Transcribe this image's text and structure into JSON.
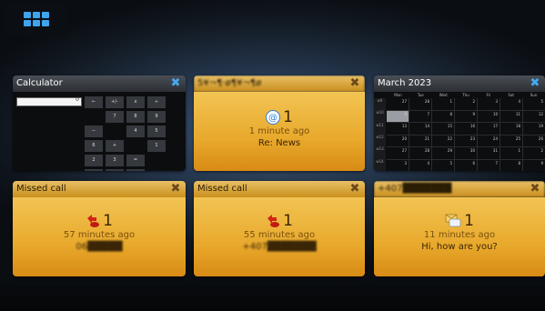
{
  "launcher": {
    "icon": "app-grid-icon"
  },
  "calculator": {
    "title": "Calculator",
    "display": "0",
    "keys": [
      "←",
      "+/-",
      "x",
      "÷",
      "",
      "7",
      "8",
      "9",
      "−",
      "",
      "4",
      "5",
      "6",
      "+",
      "",
      "1",
      "2",
      "3",
      "=",
      "",
      "0",
      ".",
      ""
    ]
  },
  "email": {
    "title": "5¥¬¶·ø¶¥¬¶ø",
    "count": "1",
    "time": "1 minute ago",
    "subject": "Re: News",
    "icon": "at-sign-icon"
  },
  "calendar": {
    "title": "March 2023",
    "weekdays": [
      "Mon",
      "Tue",
      "Wed",
      "Thu",
      "Fri",
      "Sat",
      "Sun"
    ],
    "weeks": [
      "w9",
      "w10",
      "w11",
      "w12",
      "w13",
      "w14"
    ],
    "days": [
      "27",
      "28",
      "1",
      "2",
      "3",
      "4",
      "5",
      "6",
      "7",
      "8",
      "9",
      "10",
      "11",
      "12",
      "13",
      "14",
      "15",
      "16",
      "17",
      "18",
      "19",
      "20",
      "21",
      "22",
      "23",
      "24",
      "25",
      "26",
      "27",
      "28",
      "29",
      "30",
      "31",
      "1",
      "2",
      "3",
      "4",
      "5",
      "6",
      "7",
      "8",
      "9"
    ]
  },
  "missed1": {
    "title": "Missed call",
    "count": "1",
    "time": "57 minutes ago",
    "number": "06█████",
    "icon": "missed-call-icon"
  },
  "missed2": {
    "title": "Missed call",
    "count": "1",
    "time": "55 minutes ago",
    "number": "+407███████",
    "icon": "missed-call-icon"
  },
  "sms": {
    "title": "+407███████",
    "count": "1",
    "time": "11 minutes ago",
    "message": "Hi, how are you?",
    "icon": "message-icon"
  },
  "colors": {
    "accent": "#3ea5ef",
    "card_gold": "#e8a92c",
    "card_dark": "#2b2f34"
  }
}
